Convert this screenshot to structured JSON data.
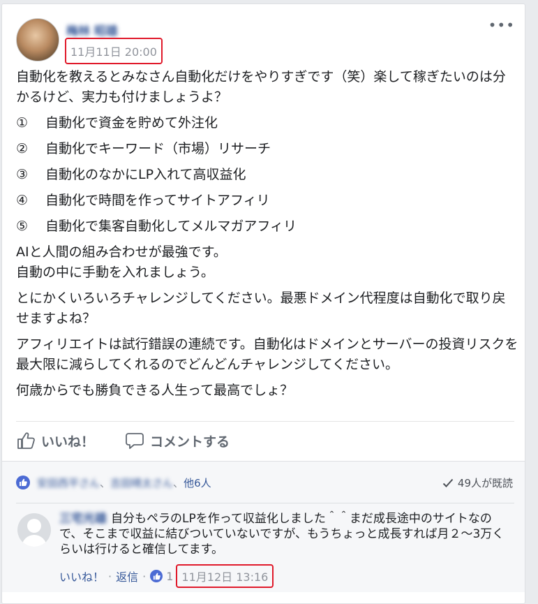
{
  "post": {
    "author": "梅林 昭雄",
    "timestamp": "11月11日 20:00",
    "more": "•••",
    "intro": "自動化を教えるとみなさん自動化だけをやりすぎです（笑）楽して稼ぎたいのは分かるけど、実力も付けましょうよ？",
    "list": [
      {
        "num": "①",
        "text": "自動化で資金を貯めて外注化"
      },
      {
        "num": "②",
        "text": "自動化でキーワード（市場）リサーチ"
      },
      {
        "num": "③",
        "text": "自動化のなかにLP入れて高収益化"
      },
      {
        "num": "④",
        "text": "自動化で時間を作ってサイトアフィリ"
      },
      {
        "num": "⑤",
        "text": "自動化で集客自動化してメルマガアフィリ"
      }
    ],
    "paragraph1_line1": "AIと人間の組み合わせが最強です。",
    "paragraph1_line2": "自動の中に手動を入れましょう。",
    "paragraph2": "とにかくいろいろチャレンジしてください。最悪ドメイン代程度は自動化で取り戻せますよね？",
    "paragraph3": "アフィリエイトは試行錯誤の連続です。自動化はドメインとサーバーの投資リスクを最大限に減らしてくれるのでどんどんチャレンジしてください。",
    "paragraph4": "何歳からでも勝負できる人生って最高でしょ？"
  },
  "actions": {
    "like_label": "いいね！",
    "comment_label": "コメントする"
  },
  "reactions": {
    "liker1": "安田西平さん",
    "liker2": "吉田晴太さん",
    "others": "他6人",
    "seen": "49人が既読"
  },
  "comment": {
    "author": "三宅光雄",
    "text": "自分もペラのLPを作って収益化しました＾＾まだ成長途中のサイトなので、そこまで収益に結びついていないですが、もうちょっと成長すれば月２～3万くらいは行けると確信してます。",
    "like_label": "いいね！",
    "reply_label": "返信",
    "like_count": "1",
    "timestamp": "11月12日 13:16"
  },
  "colors": {
    "link": "#365899",
    "muted": "#90949c",
    "like_blue": "#4c6bd4",
    "highlight_red": "#e0192a"
  }
}
